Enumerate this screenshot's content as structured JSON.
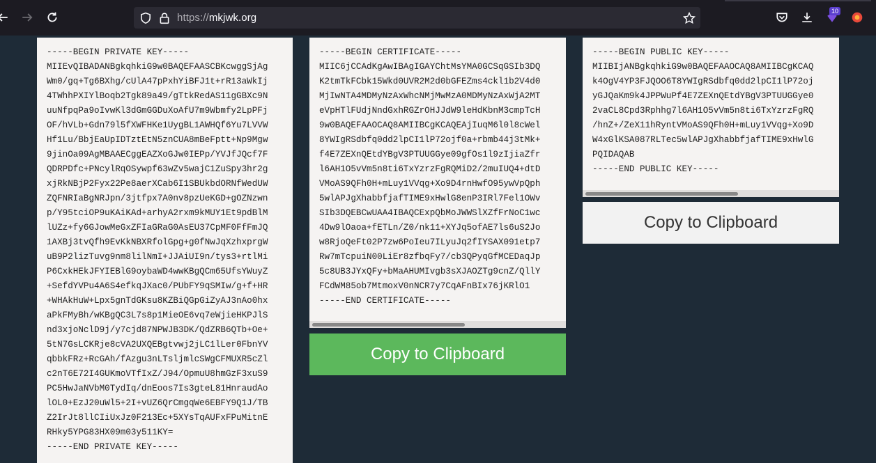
{
  "browser": {
    "url_prefix": "https://",
    "url_domain": "mkjwk.org",
    "extensions_badge": "10"
  },
  "private_key": {
    "lines": [
      "-----BEGIN PRIVATE KEY-----",
      "MIIEvQIBADANBgkqhkiG9w0BAQEFAASCBKcwggSjAg",
      "Wm0/gq+Tg6BXhg/cUlA47pPxhYiBFJ1t+rR13aWkIj",
      "4TWhhPXIYlBoqb2Tgk89a49/gTtkRedAS11gGBXc9N",
      "uuNfpqPa9oIvwKl3dGmGGDuXoAfU7m9Wbmfy2LpPFj",
      "OF/hVLb+Gdn79l5fXWFHKe1UygBL1AWHQf6Yu7LVVW",
      "Hf1Lu/BbjEaUpIDTztEtN5znCUA8mBeFptt+Np9Mgw",
      "9jinOa09AgMBAAECggEAZXoGJw0IEPp/YVJfJQcf7F",
      "QDRPDfc+PNcylRqOSywpf63wZv5wajC1ZuSpy3hr2g",
      "xjRkNBjP2Fyx22Pe8aerXCab6I1SBUkbdORNfWedUW",
      "ZQFNRIaBgNRJpn/3jtfpx7A0nv8pzUeKGD+gOZNzwn",
      "p/Y95tciOP9uKAiKAd+arhyA2rxm9kMUY1Et9pdBlM",
      "lUZz+fy6GJowMeGxZFIaGRaG0AsEU37CpMF0FfFmJQ",
      "1AXBj3tvQfh9EvKkNBXRfolGpg+g0fNwJqXzhxprgW",
      "uB9P2lizTuvg9nm8lilNmI+JJAiUI9n/tys3+rtlMi",
      "P6CxkHEkJFYIEBlG9oybaWD4wwKBgQCm65UfsYWuyZ",
      "+SefdYVPu4A6S4efkqJXac0/PUbFY9qSMIw/g+f+HR",
      "+WHAkHuW+Lpx5gnTdGKsu8KZBiQGpGiZyAJ3nAo0hx",
      "aPkFMyBh/wKBgQC3L7s8p1MieOE6vq7eWjieHKPJlS",
      "nd3xjoNclD9j/y7cjd87NPWJB3DK/QdZRB6QTb+Oe+",
      "5tN7GsLCKRje8cVA2UXQEBgtvwj2jLC1lLer0FbnYV",
      "qbbkFRz+RcGAh/fAzgu3nLTsljmlcSWgCFMUXR5cZl",
      "c2nT6E72I4GUKmoVTfIxZ/J94/OpmuU8hmGzF3xuS9",
      "PC5HwJaNVbM0TydIq/dnEoos7Is3gteL81HnraudAo",
      "lOL0+EzJ20uWl5+2I+vUZ6QrCmgqWe6EBFY9Q1J/TB",
      "Z2IrJt8llCIiUxJz0F213Ec+5XYsTqAUFxFPuMitnE",
      "RHky5YPG83HX09m03y511KY=",
      "-----END PRIVATE KEY-----"
    ]
  },
  "certificate": {
    "lines": [
      "-----BEGIN CERTIFICATE-----",
      "MIIC6jCCAdKgAwIBAgIGAYChtMsYMA0GCSqGSIb3DQ",
      "K2tmTkFCbk15Wkd0UVR2M2d0bGFEZms4ckl1b2V4d0",
      "MjIwNTA4MDMyNzAxWhcNMjMwMzA0MDMyNzAxWjA2MT",
      "eVpHTlFUdjNndGxhRGZrOHJJdW9leHdKbnM3cmpTcH",
      "9w0BAQEFAAOCAQ8AMIIBCgKCAQEAjIuqM6l0l8cWel",
      "8YWIgRSdbfq0dd2lpCI1lP72ojf0a+rbmb44j3tMk+",
      "f4E7ZEXnQEtdYBgV3PTUUGGye09gfOs1l9zIjiaZfr",
      "l6AH1O5vVm5n8ti6TxYzrzFgRQMiD2/2muIUQ4+dtD",
      "VMoAS9QFh0H+mLuy1VVqg+Xo9D4rnHwfO95ywVpQph",
      "5wlAPJgXhabbfjafTIME9xHwlG8enP3IRl7Fel1OWv",
      "SIb3DQEBCwUAA4IBAQCExpQbMoJWWSlXZfFrNoC1wc",
      "4Dw9lOaoa+fETLn/Z0/nk11+XYJq5ofAE7ls6uS2Jo",
      "w8RjoQeFt02P7zw6PoIeu7ILyuJq2fIYSAX091etp7",
      "Rw7mTcpuiN00LiEr8zfbqFy7/cb3QPyqGfMCEDaqJp",
      "5c8UB3JYxQFy+bMaAHUMIvgb3sXJAOZTg9cnZ/QllY",
      "FCdWM85ob7MtmoxV0nNCR7y7CqAFnBIx76jKRlO1",
      "-----END CERTIFICATE-----"
    ]
  },
  "public_key": {
    "lines": [
      "-----BEGIN PUBLIC KEY-----",
      "MIIBIjANBgkqhkiG9w0BAQEFAAOCAQ8AMIIBCgKCAQ",
      "k4OgV4YP3FJQOO6T8YWIgRSdbfq0dd2lpCI1lP72oj",
      "yGJQaKm9k4JPPWuPf4E7ZEXnQEtdYBgV3PTUUGGye0",
      "2vaCL8Cpd3Rphhg7l6AH1O5vVm5n8ti6TxYzrzFgRQ",
      "/hnZ+/ZeX11hRyntVMoAS9QFh0H+mLuy1VVqg+Xo9D",
      "W4xGlKSA087RLTec5wlAPJgXhabbfjafTIME9xHwlG",
      "PQIDAQAB",
      "-----END PUBLIC KEY-----"
    ]
  },
  "buttons": {
    "copy_certificate": "Copy to Clipboard",
    "copy_public_key": "Copy to Clipboard"
  },
  "colors": {
    "page_bg": "#1e2b37",
    "panel_bg": "#f5f3f2",
    "primary_button": "#5cb85c",
    "default_button": "#f2f2f2"
  },
  "icons": [
    "back-arrow-icon",
    "forward-arrow-icon",
    "reload-icon",
    "shield-icon",
    "lock-icon",
    "star-icon",
    "pocket-icon",
    "download-icon",
    "extension-icon",
    "firefox-account-icon"
  ]
}
